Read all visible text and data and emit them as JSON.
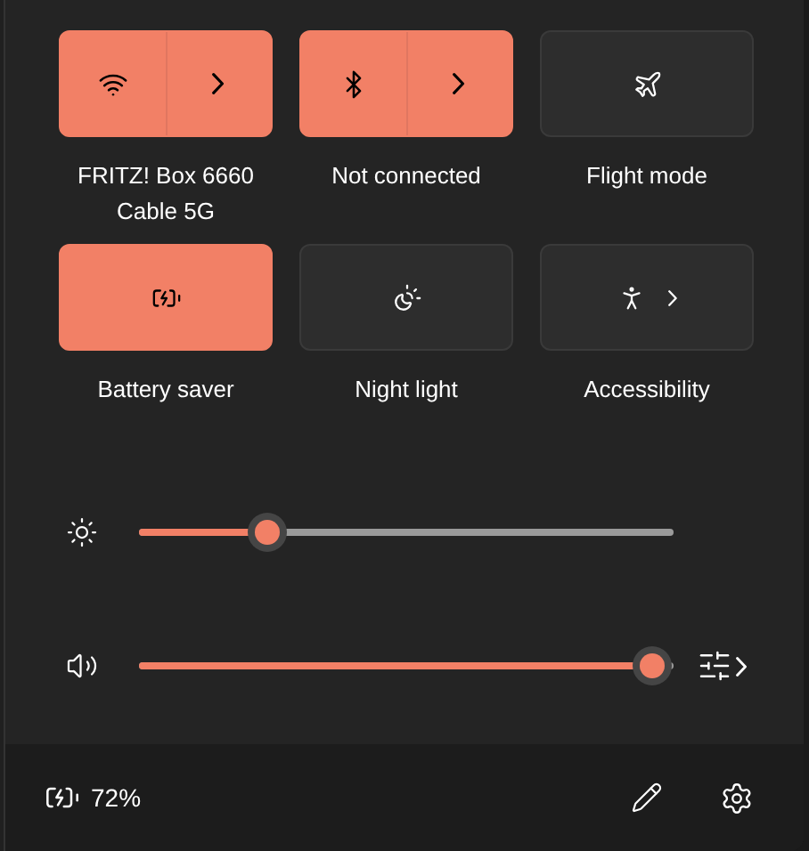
{
  "tiles": [
    {
      "kind": "split",
      "label": "FRITZ! Box 6660 Cable 5G",
      "on": true
    },
    {
      "kind": "split",
      "label": "Not connected",
      "on": true
    },
    {
      "kind": "plain",
      "label": "Flight mode",
      "on": false
    },
    {
      "kind": "plain",
      "label": "Battery saver",
      "on": true
    },
    {
      "kind": "plain",
      "label": "Night light",
      "on": false
    },
    {
      "kind": "chevron",
      "label": "Accessibility",
      "on": false
    }
  ],
  "sliders": [
    {
      "kind": "brightness",
      "level": 0.24
    },
    {
      "kind": "volume",
      "level": 0.96
    }
  ],
  "footer": {
    "battery": "72%"
  }
}
